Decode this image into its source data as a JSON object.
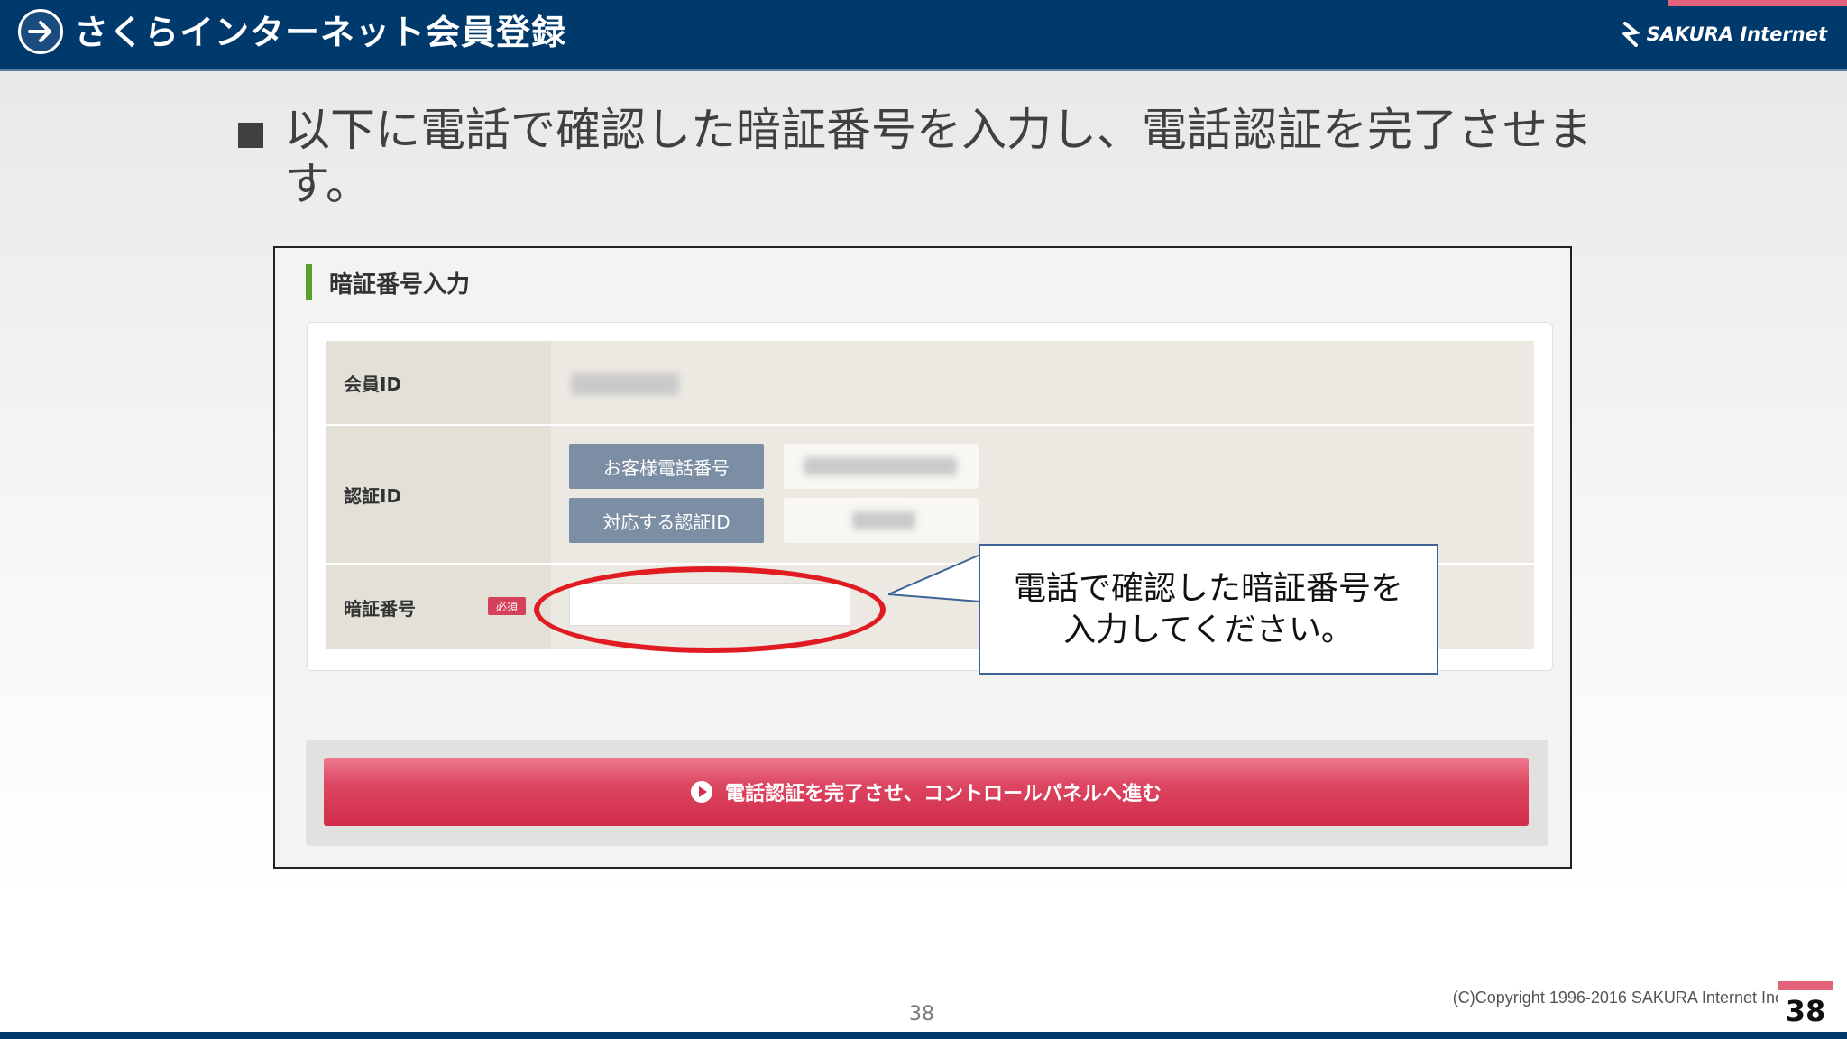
{
  "header": {
    "title": "さくらインターネット会員登録",
    "logo_text": "SAKURA Internet"
  },
  "bullet": {
    "text": "以下に電話で確認した暗証番号を入力し、電話認証を完了させます。"
  },
  "form": {
    "section_title": "暗証番号入力",
    "member_id_label": "会員ID",
    "auth_id_label": "認証ID",
    "customer_phone_button": "お客様電話番号",
    "corresponding_auth_id_button": "対応する認証ID",
    "pin_label": "暗証番号",
    "required_badge": "必須",
    "submit_label": "電話認証を完了させ、コントロールパネルへ進む"
  },
  "callout": {
    "line1": "電話で確認した暗証番号を",
    "line2": "入力してください。"
  },
  "footer": {
    "page_number": "38",
    "copyright": "(C)Copyright 1996-2016 SAKURA Internet Inc.",
    "page_badge": "38"
  },
  "colors": {
    "header_bg": "#003a6d",
    "accent_pink": "#e2637a",
    "submit_red": "#d12c4b",
    "ellipse_red": "#e11b22",
    "section_green": "#5aa02c"
  }
}
